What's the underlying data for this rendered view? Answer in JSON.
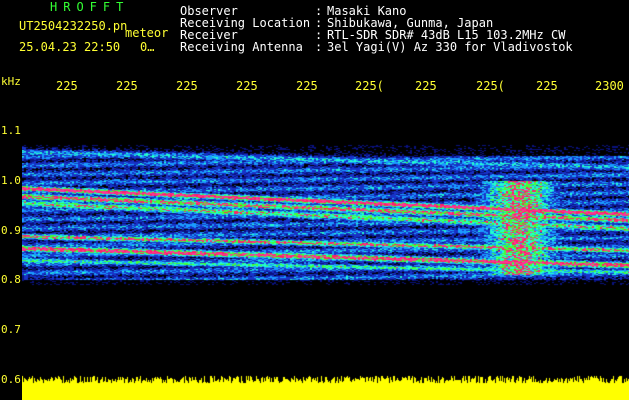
{
  "header": {
    "title": "HROFFT",
    "filename": "UT2504232250.pn",
    "meteor_label": "meteor",
    "datetime": "25.04.23 22:50",
    "count": "0…"
  },
  "info": {
    "observer_label": "Observer",
    "observer_value": "Masaki Kano",
    "location_label": "Receiving Location",
    "location_value": "Shibukawa, Gunma, Japan",
    "receiver_label": "Receiver",
    "receiver_value": "RTL-SDR SDR# 43dB L15 103.2MHz CW",
    "antenna_label": "Receiving Antenna",
    "antenna_value": "3el Yagi(V) Az 330 for Vladivostok"
  },
  "axes": {
    "y_unit": "kHz",
    "x_ticks": [
      "225",
      "225",
      "225",
      "225",
      "225",
      "225(",
      "225",
      "225(",
      "225",
      "2300"
    ],
    "y_ticks": [
      "1.1",
      "1.0",
      "0.9",
      "0.8",
      "0.7",
      "0.6"
    ]
  },
  "colors": {
    "background": "#000000",
    "header_green": "#33ff33",
    "label_yellow": "#ffff33",
    "info_white": "#ffffff",
    "noise_floor": "#ffff00"
  }
}
